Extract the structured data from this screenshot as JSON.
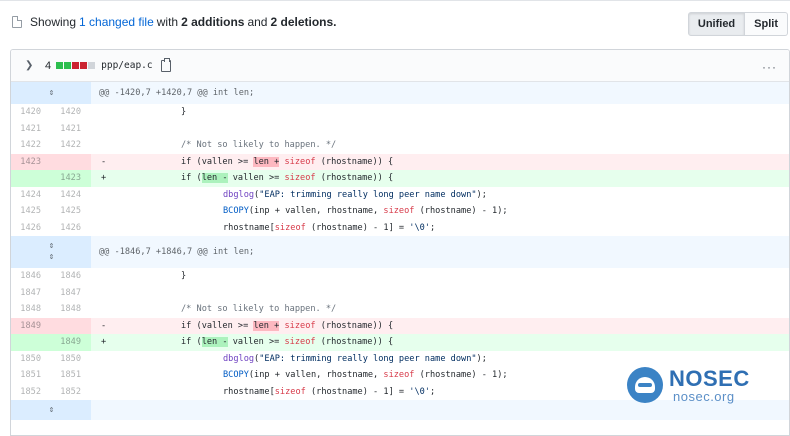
{
  "summary": {
    "prefix": "Showing",
    "changed_files": "1 changed file",
    "mid": "with",
    "additions": "2 additions",
    "and": "and",
    "deletions": "2 deletions."
  },
  "view_toggle": {
    "unified": "Unified",
    "split": "Split"
  },
  "file": {
    "change_count": "4",
    "stat_bar": [
      "add",
      "add",
      "del",
      "del",
      "neutral"
    ],
    "name": "ppp/eap.c",
    "menu": "···"
  },
  "hunks": [
    {
      "header": "@@ -1420,7 +1420,7 @@ int len;",
      "lines": [
        {
          "type": "ctx",
          "old": "1420",
          "new": "1420",
          "code": "}"
        },
        {
          "type": "ctx",
          "old": "1421",
          "new": "1421",
          "code": ""
        },
        {
          "type": "ctx",
          "old": "1422",
          "new": "1422",
          "code": "/* Not so likely to happen. */"
        },
        {
          "type": "del",
          "old": "1423",
          "new": "",
          "mark": "-",
          "code": "if (vallen >= len + sizeof (rhostname)) {"
        },
        {
          "type": "add",
          "old": "",
          "new": "1423",
          "mark": "+",
          "code": "if (len - vallen >= sizeof (rhostname)) {"
        },
        {
          "type": "ctx",
          "old": "1424",
          "new": "1424",
          "code": "dbglog(\"EAP: trimming really long peer name down\");"
        },
        {
          "type": "ctx",
          "old": "1425",
          "new": "1425",
          "code": "BCOPY(inp + vallen, rhostname, sizeof (rhostname) - 1);"
        },
        {
          "type": "ctx",
          "old": "1426",
          "new": "1426",
          "code": "rhostname[sizeof (rhostname) - 1] = '\\0';"
        }
      ]
    },
    {
      "header": "@@ -1846,7 +1846,7 @@ int len;",
      "lines": [
        {
          "type": "ctx",
          "old": "1846",
          "new": "1846",
          "code": "}"
        },
        {
          "type": "ctx",
          "old": "1847",
          "new": "1847",
          "code": ""
        },
        {
          "type": "ctx",
          "old": "1848",
          "new": "1848",
          "code": "/* Not so likely to happen. */"
        },
        {
          "type": "del",
          "old": "1849",
          "new": "",
          "mark": "-",
          "code": "if (vallen >= len + sizeof (rhostname)) {"
        },
        {
          "type": "add",
          "old": "",
          "new": "1849",
          "mark": "+",
          "code": "if (len - vallen >= sizeof (rhostname)) {"
        },
        {
          "type": "ctx",
          "old": "1850",
          "new": "1850",
          "code": "dbglog(\"EAP: trimming really long peer name down\");"
        },
        {
          "type": "ctx",
          "old": "1851",
          "new": "1851",
          "code": "BCOPY(inp + vallen, rhostname, sizeof (rhostname) - 1);"
        },
        {
          "type": "ctx",
          "old": "1852",
          "new": "1852",
          "code": "rhostname[sizeof (rhostname) - 1] = '\\0';"
        }
      ]
    }
  ],
  "watermark": {
    "brand": "NOSEC",
    "domain": "nosec.org"
  }
}
